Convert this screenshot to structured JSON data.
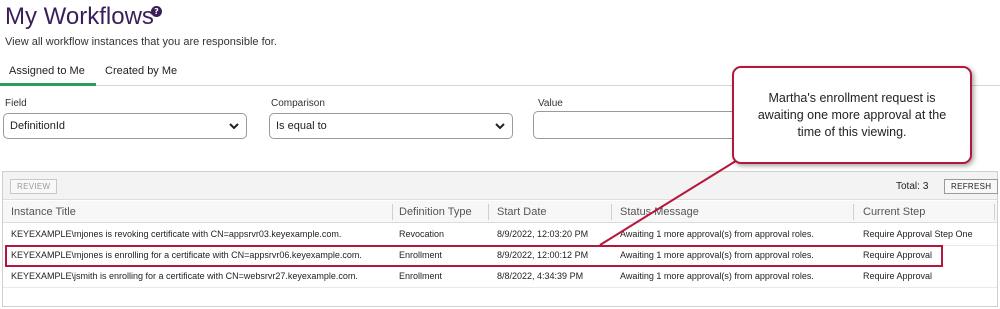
{
  "header": {
    "title": "My Workflows",
    "help_icon": "?",
    "subtitle": "View all workflow instances that you are responsible for."
  },
  "tabs": [
    {
      "label": "Assigned to Me",
      "active": true
    },
    {
      "label": "Created by Me",
      "active": false
    }
  ],
  "filters": {
    "field": {
      "label": "Field",
      "value": "DefinitionId"
    },
    "comparison": {
      "label": "Comparison",
      "value": "Is equal to"
    },
    "value": {
      "label": "Value",
      "value": ""
    }
  },
  "toolbar": {
    "review_label": "REVIEW",
    "total_label": "Total:",
    "total_count": "3",
    "refresh_label": "REFRESH"
  },
  "columns": [
    "Instance Title",
    "Definition Type",
    "Start Date",
    "Status Message",
    "Current Step"
  ],
  "rows": [
    {
      "title": "KEYEXAMPLE\\mjones is revoking certificate with CN=appsrvr03.keyexample.com.",
      "type": "Revocation",
      "start": "8/9/2022, 12:03:20 PM",
      "status": "Awaiting 1 more approval(s) from approval roles.",
      "step": "Require Approval Step One"
    },
    {
      "title": "KEYEXAMPLE\\mjones is enrolling for a certificate with CN=appsrvr06.keyexample.com.",
      "type": "Enrollment",
      "start": "8/9/2022, 12:00:12 PM",
      "status": "Awaiting 1 more approval(s) from approval roles.",
      "step": "Require Approval"
    },
    {
      "title": "KEYEXAMPLE\\jsmith is enrolling for a certificate with CN=websrvr27.keyexample.com.",
      "type": "Enrollment",
      "start": "8/8/2022, 4:34:39 PM",
      "status": "Awaiting 1 more approval(s) from approval roles.",
      "step": "Require Approval"
    }
  ],
  "callout": {
    "text": "Martha's enrollment request is awaiting one more approval at the time of this viewing."
  },
  "colors": {
    "title": "#3a1e5a",
    "active_tab": "#2a9d5b",
    "highlight": "#b5163c"
  }
}
